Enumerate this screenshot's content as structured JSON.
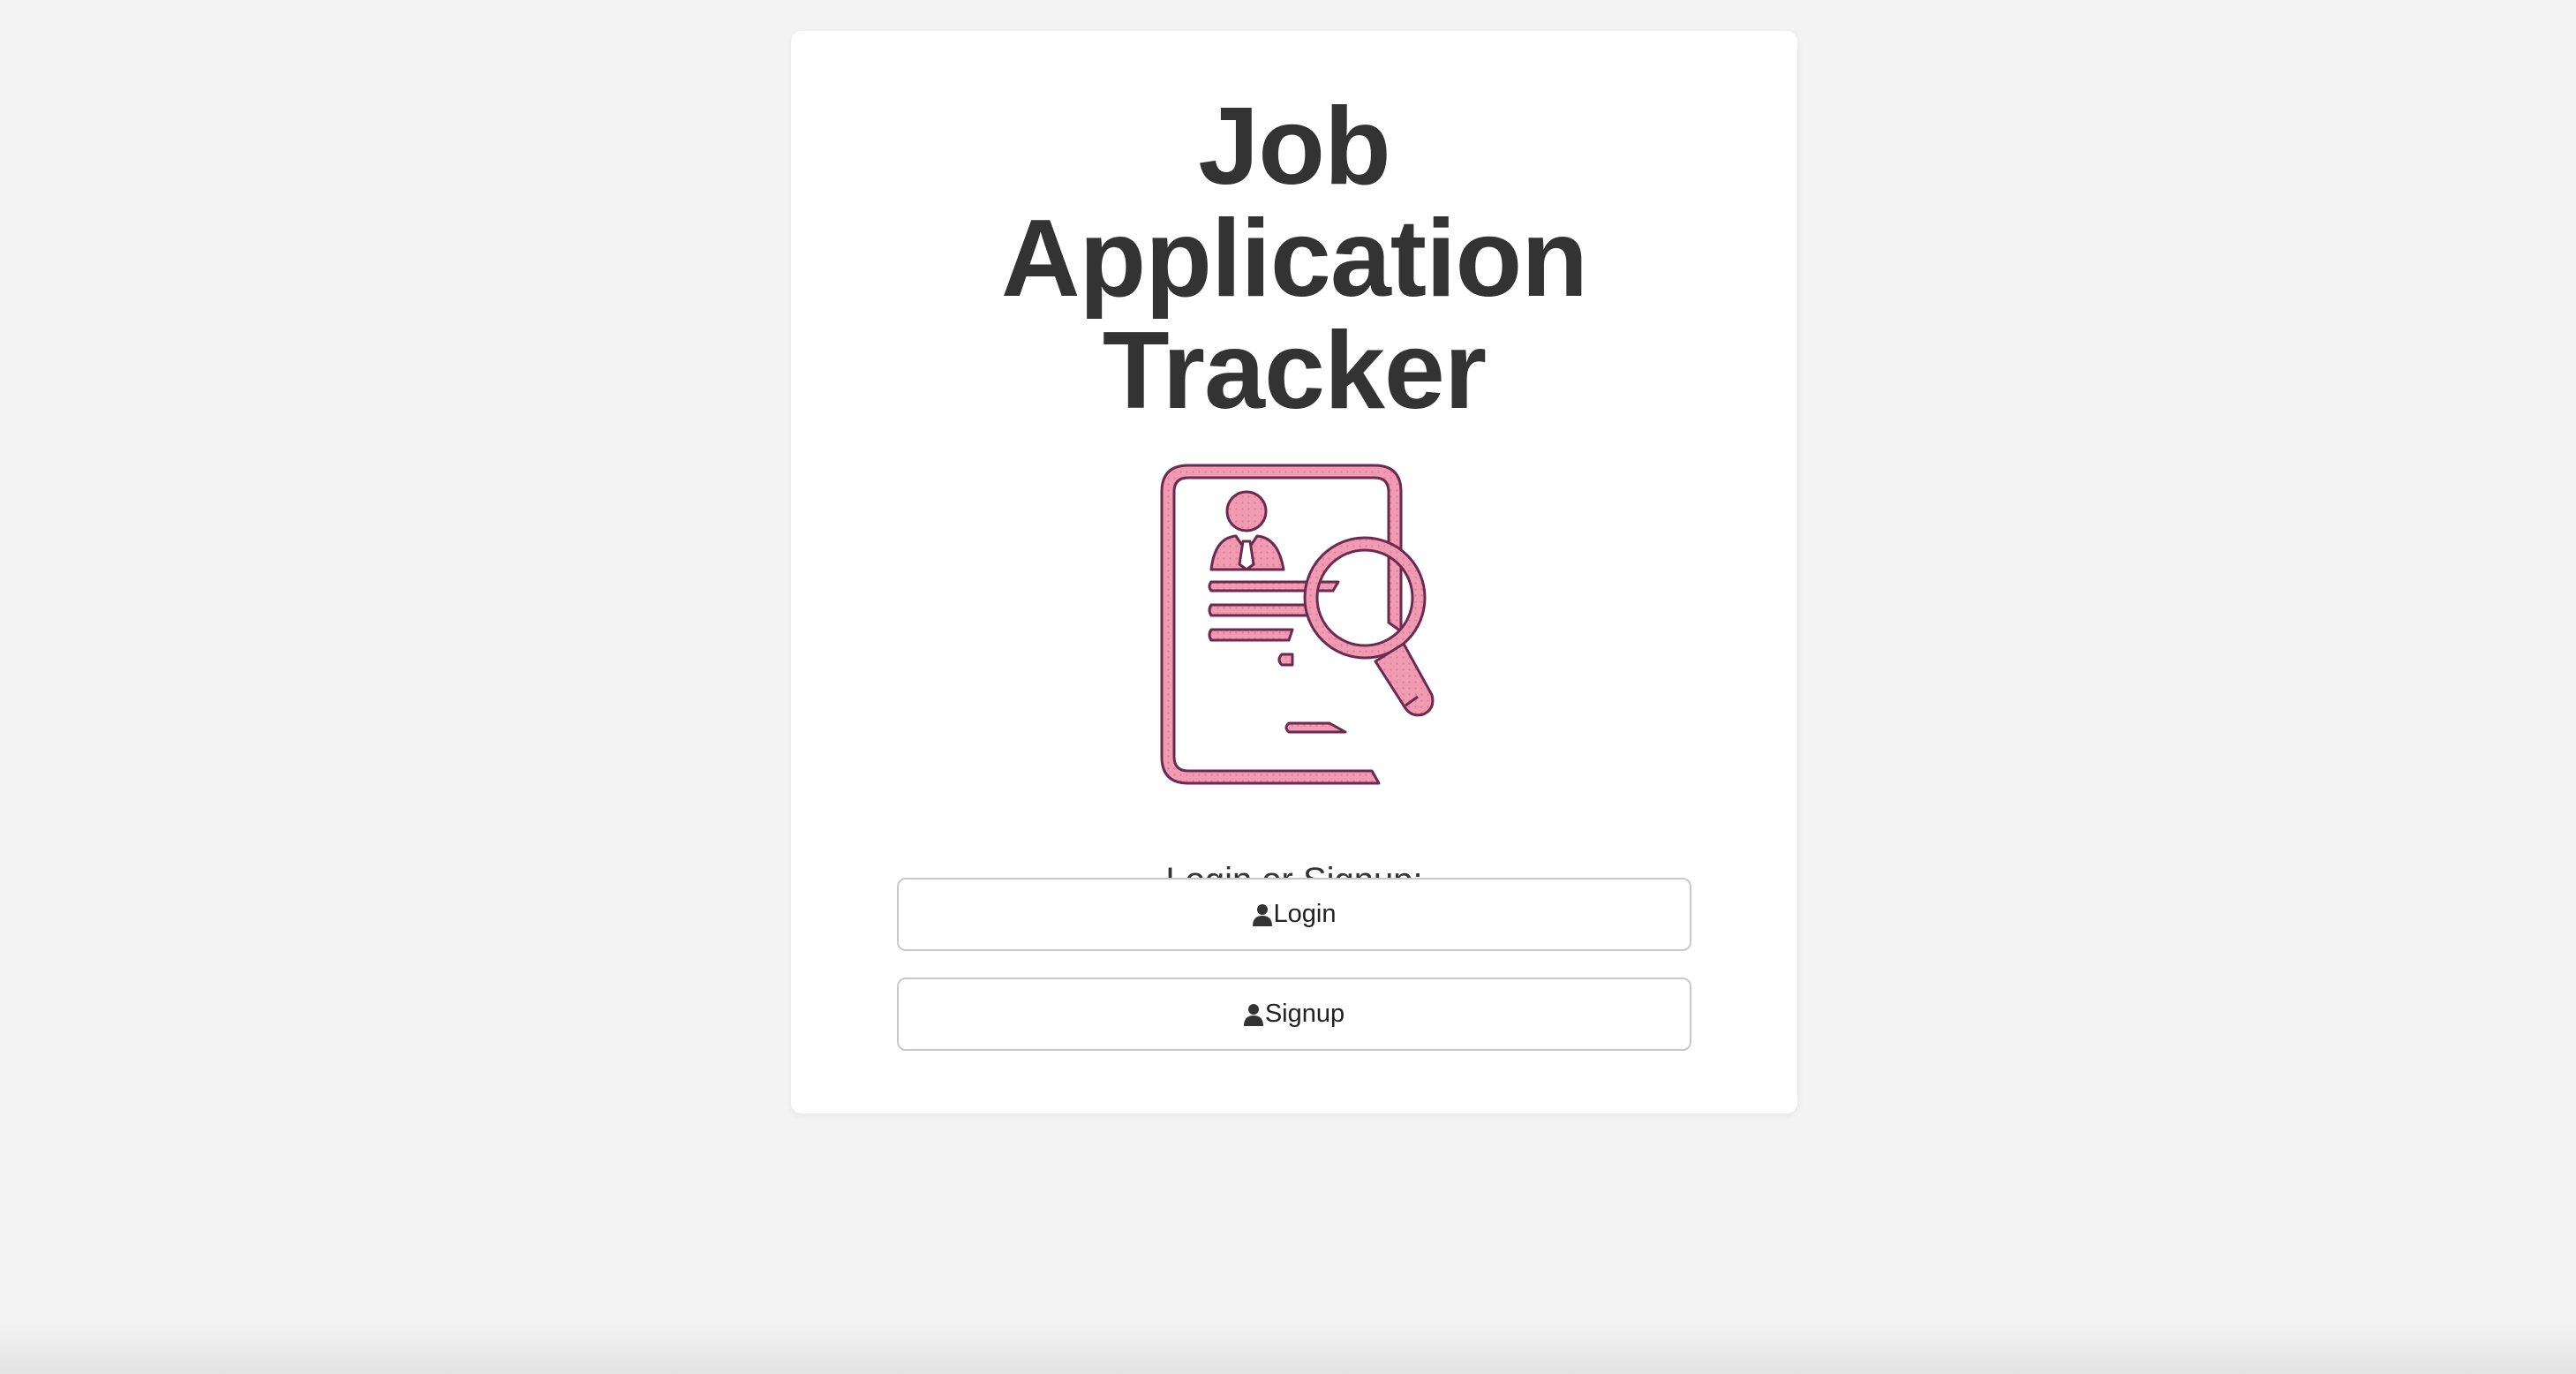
{
  "app": {
    "title_lines": [
      "Job",
      "Application",
      "Tracker"
    ],
    "logo_icon": "resume-search-icon"
  },
  "auth": {
    "prompt": "Login or Signup:",
    "login_label": "Login",
    "signup_label": "Signup",
    "button_icon": "user-icon"
  },
  "colors": {
    "background": "#f3f3f3",
    "card": "#ffffff",
    "text": "#333333",
    "icon_fill": "#f19bb2",
    "icon_stroke": "#6b2a4f"
  }
}
